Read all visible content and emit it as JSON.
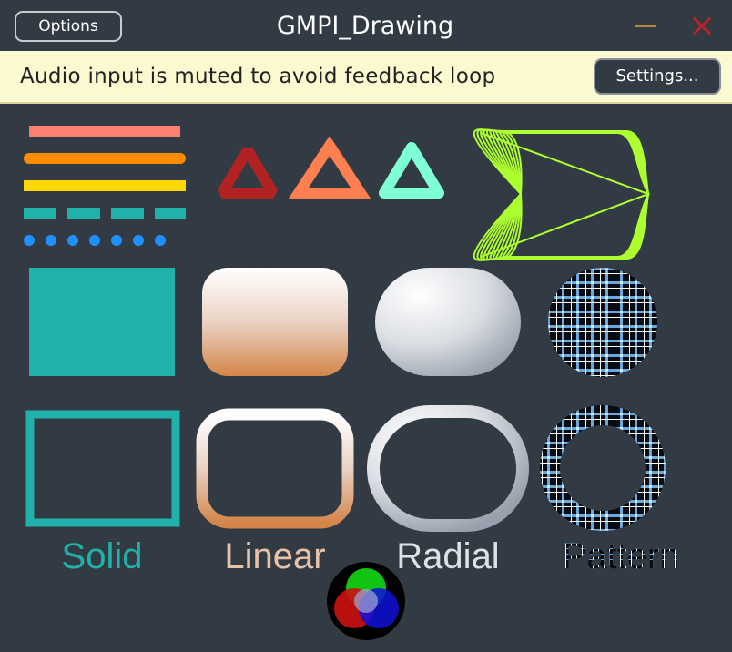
{
  "window": {
    "title": "GMPI_Drawing",
    "options_label": "Options",
    "minimize_icon": "minimize-icon",
    "close_icon": "close-icon"
  },
  "banner": {
    "message": "Audio input is muted to avoid feedback loop",
    "settings_label": "Settings..."
  },
  "labels": {
    "solid": "Solid",
    "linear": "Linear",
    "radial": "Radial",
    "pattern": "Pattern"
  },
  "colors": {
    "background": "#323b43",
    "banner": "#fbf9d0",
    "salmon": "#fa8072",
    "orange": "#ff8c00",
    "gold": "#ffd700",
    "teal": "#20b2aa",
    "blue": "#1e90ff",
    "firebrick": "#b22222",
    "coral": "#ff7f50",
    "aquamarine": "#7fffd4",
    "lime": "#adff2f"
  }
}
